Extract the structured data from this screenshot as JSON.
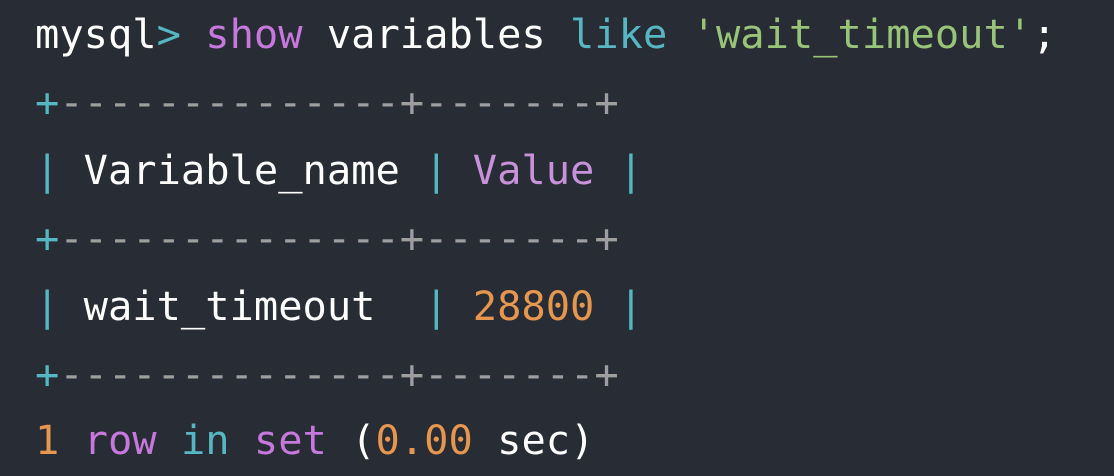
{
  "colors": {
    "background": "#282c34",
    "text": "#ffffff",
    "keyword": "#c678dd",
    "operator": "#56b6c2",
    "string": "#98c379",
    "number": "#e5964f",
    "border": "#9e9e9e"
  },
  "command": {
    "prompt": "mysql",
    "prompt_symbol": ">",
    "keyword_show": "show",
    "word_variables": "variables",
    "keyword_like": "like",
    "string_value": "'wait_timeout'",
    "terminator": ";"
  },
  "table": {
    "border_plus": "+",
    "border_dashes_col1": "--------------",
    "border_dashes_col2": "-------",
    "pipe": "|",
    "header_name": "Variable_name",
    "header_value": "Value",
    "row_name": "wait_timeout",
    "row_value": "28800"
  },
  "summary": {
    "count": "1",
    "word_row": "row",
    "word_in": "in",
    "word_set": "set",
    "paren_open": "(",
    "elapsed": "0.00",
    "unit": "sec",
    "paren_close": ")"
  }
}
